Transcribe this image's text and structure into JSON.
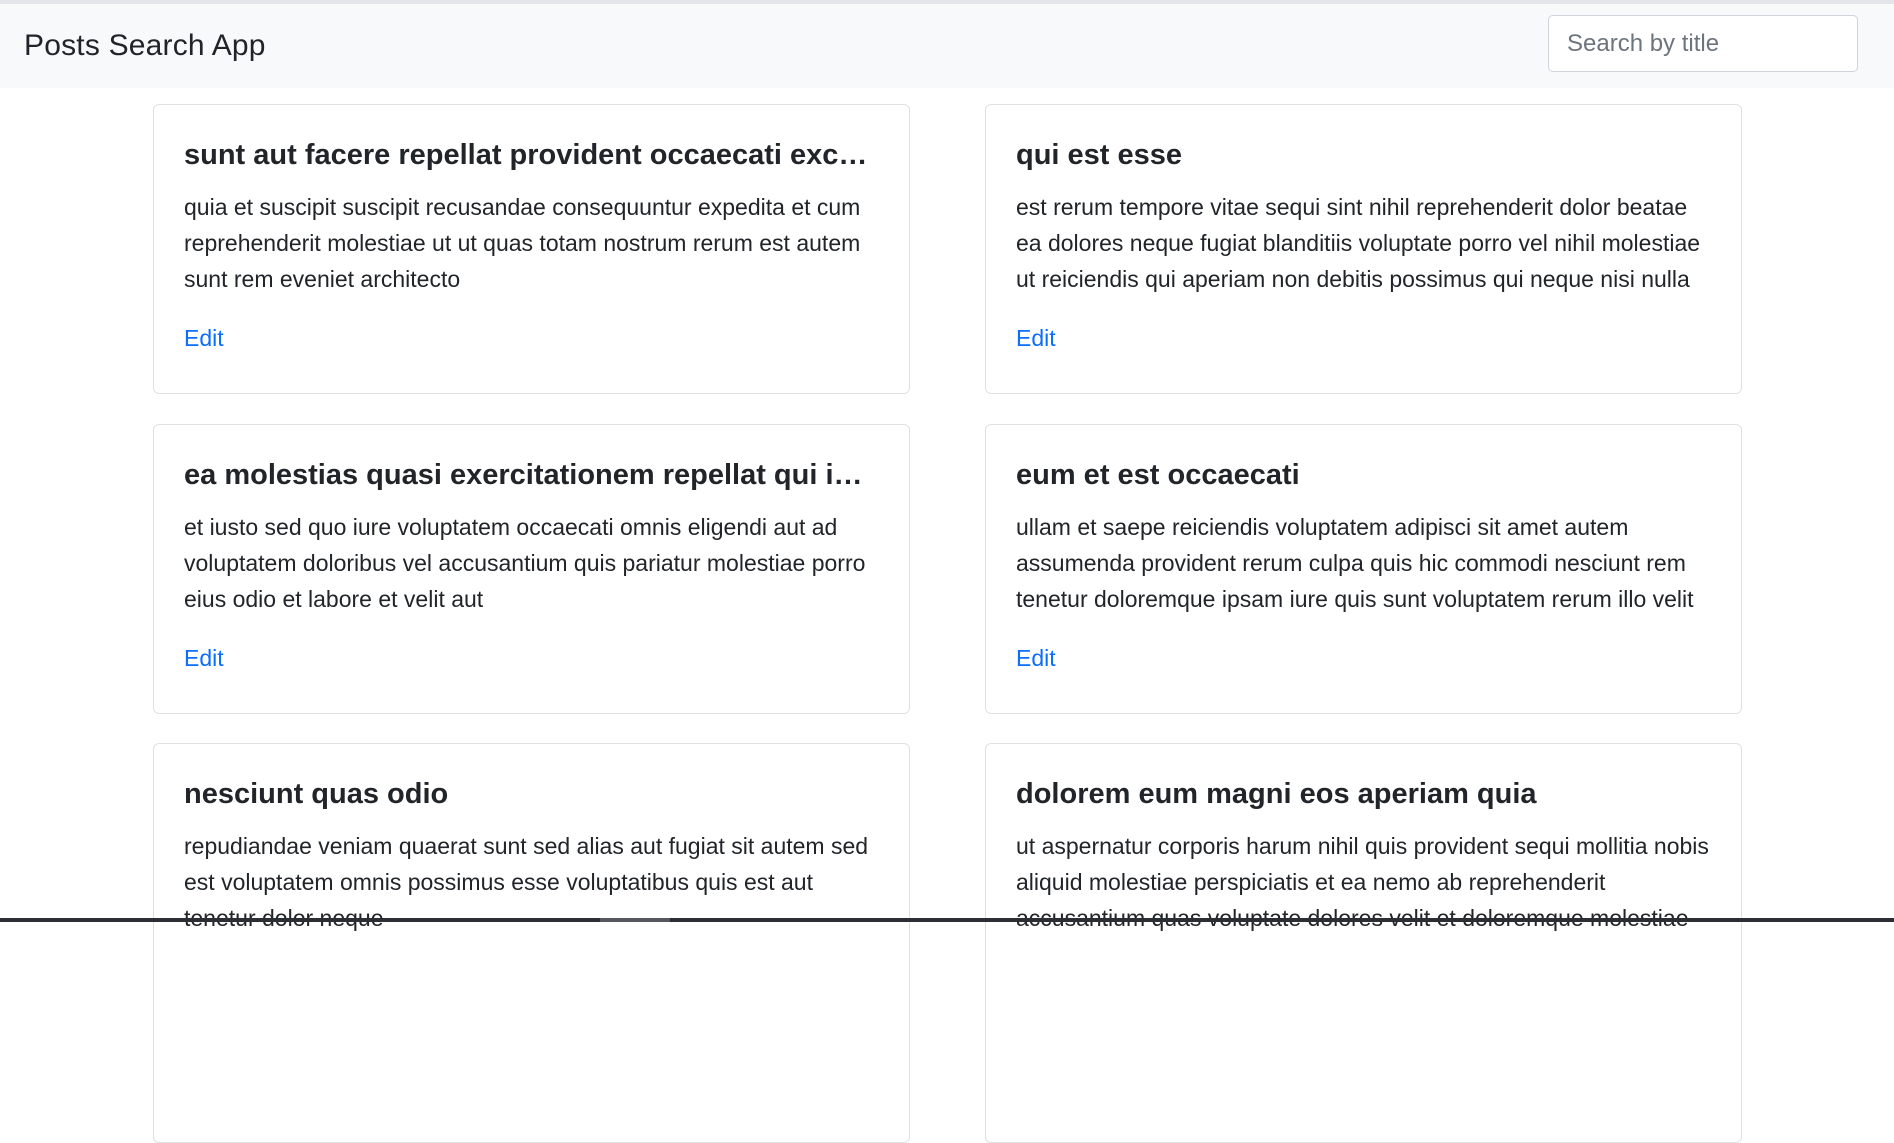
{
  "app": {
    "title": "Posts Search App"
  },
  "search": {
    "placeholder": "Search by title",
    "value": ""
  },
  "posts": [
    {
      "title": "sunt aut facere repellat provident occaecati excepturi optio reprehenderit",
      "body": "quia et suscipit suscipit recusandae consequuntur expedita et cum reprehenderit molestiae ut ut quas totam nostrum rerum est autem sunt rem eveniet architecto",
      "link": "Edit"
    },
    {
      "title": "qui est esse",
      "body": "est rerum tempore vitae sequi sint nihil reprehenderit dolor beatae ea dolores neque fugiat blanditiis voluptate porro vel nihil molestiae ut reiciendis qui aperiam non debitis possimus qui neque nisi nulla",
      "link": "Edit"
    },
    {
      "title": "ea molestias quasi exercitationem repellat qui ipsa sit aut",
      "body": "et iusto sed quo iure voluptatem occaecati omnis eligendi aut ad voluptatem doloribus vel accusantium quis pariatur molestiae porro eius odio et labore et velit aut",
      "link": "Edit"
    },
    {
      "title": "eum et est occaecati",
      "body": "ullam et saepe reiciendis voluptatem adipisci sit amet autem assumenda provident rerum culpa quis hic commodi nesciunt rem tenetur doloremque ipsam iure quis sunt voluptatem rerum illo velit",
      "link": "Edit"
    },
    {
      "title": "nesciunt quas odio",
      "body": "repudiandae veniam quaerat sunt sed alias aut fugiat sit autem sed est voluptatem omnis possimus esse voluptatibus quis est aut tenetur dolor neque",
      "link": ""
    },
    {
      "title": "dolorem eum magni eos aperiam quia",
      "body": "ut aspernatur corporis harum nihil quis provident sequi mollitia nobis aliquid molestiae perspiciatis et ea nemo ab reprehenderit accusantium quas voluptate dolores velit et doloremque molestiae",
      "link": ""
    }
  ],
  "colors": {
    "accent": "#0d6efd",
    "navbar_bg": "#f8f9fa",
    "text": "#212529",
    "border": "#dfe2e5"
  }
}
